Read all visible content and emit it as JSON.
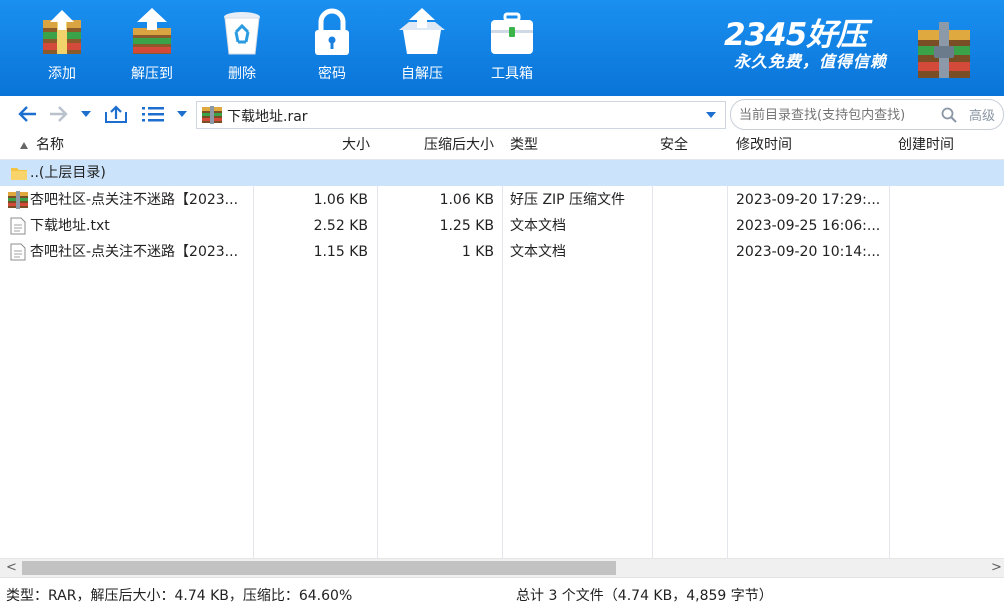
{
  "toolbar": {
    "buttons": [
      {
        "label": "添加",
        "icon": "add-archive-icon"
      },
      {
        "label": "解压到",
        "icon": "extract-to-icon"
      },
      {
        "label": "删除",
        "icon": "recycle-bin-icon"
      },
      {
        "label": "密码",
        "icon": "lock-icon"
      },
      {
        "label": "自解压",
        "icon": "self-extract-icon"
      },
      {
        "label": "工具箱",
        "icon": "toolbox-icon"
      }
    ],
    "brand_title": "2345好压",
    "brand_slogan": "永久免费，值得信赖"
  },
  "navbar": {
    "address": "下载地址.rar",
    "search_placeholder": "当前目录查找(支持包内查找)",
    "advanced_label": "高级"
  },
  "columns": {
    "name": "名称",
    "size": "大小",
    "packed": "压缩后大小",
    "type": "类型",
    "security": "安全",
    "modified": "修改时间",
    "created": "创建时间"
  },
  "parent_dir": "..(上层目录)",
  "files": [
    {
      "name": "杏吧社区-点关注不迷路【2023...",
      "size": "1.06 KB",
      "packed": "1.06 KB",
      "type": "好压 ZIP 压缩文件",
      "security": "",
      "modified": "2023-09-20 17:29:...",
      "created": ""
    },
    {
      "name": "下载地址.txt",
      "size": "2.52 KB",
      "packed": "1.25 KB",
      "type": "文本文档",
      "security": "",
      "modified": "2023-09-25 16:06:...",
      "created": ""
    },
    {
      "name": "杏吧社区-点关注不迷路【2023...",
      "size": "1.15 KB",
      "packed": "1 KB",
      "type": "文本文档",
      "security": "",
      "modified": "2023-09-20 10:14:...",
      "created": ""
    }
  ],
  "scrollbar": {
    "left_arrow": "<",
    "right_arrow": ">"
  },
  "status": {
    "left": "类型：RAR，解压后大小：4.74 KB，压缩比：64.60%",
    "right": "总计 3 个文件（4.74 KB，4,859 字节）"
  },
  "colors": {
    "toolbar_top": "#1a90f0",
    "toolbar_bottom": "#0a74d8",
    "selected_row": "#cce4fb",
    "accent": "#1d6fcf"
  }
}
